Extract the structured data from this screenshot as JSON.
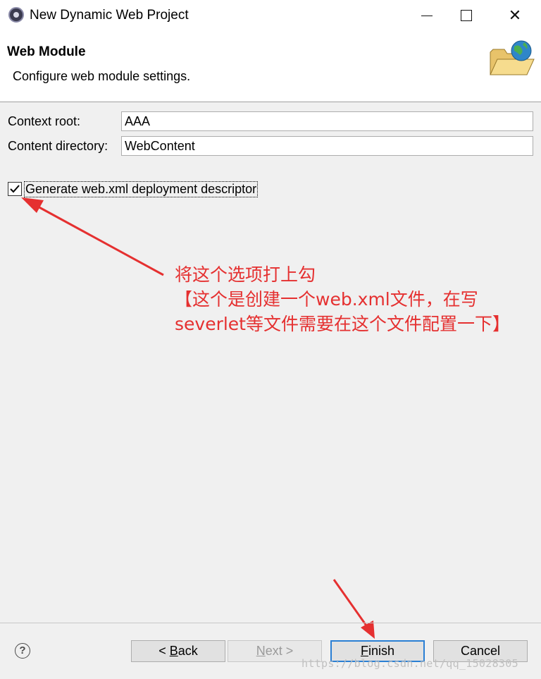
{
  "window": {
    "title": "New Dynamic Web Project",
    "icon": "eclipse-icon"
  },
  "header": {
    "title": "Web Module",
    "description": "Configure web module settings.",
    "graphic": "folder-globe-icon"
  },
  "form": {
    "context_root_label": "Context root:",
    "context_root_value": "AAA",
    "content_dir_label": "Content directory:",
    "content_dir_value": "WebContent",
    "generate_xml_label": "Generate web.xml deployment descriptor",
    "generate_xml_checked": true
  },
  "annotation": {
    "line1": "将这个选项打上勾",
    "line2": "【这个是创建一个web.xml文件，在写",
    "line3": "severlet等文件需要在这个文件配置一下】",
    "color": "#e53030"
  },
  "footer": {
    "help": "?",
    "back": "< Back",
    "next": "Next >",
    "finish": "Finish",
    "cancel": "Cancel"
  },
  "watermark": "https://blog.csdn.net/qq_15028305"
}
